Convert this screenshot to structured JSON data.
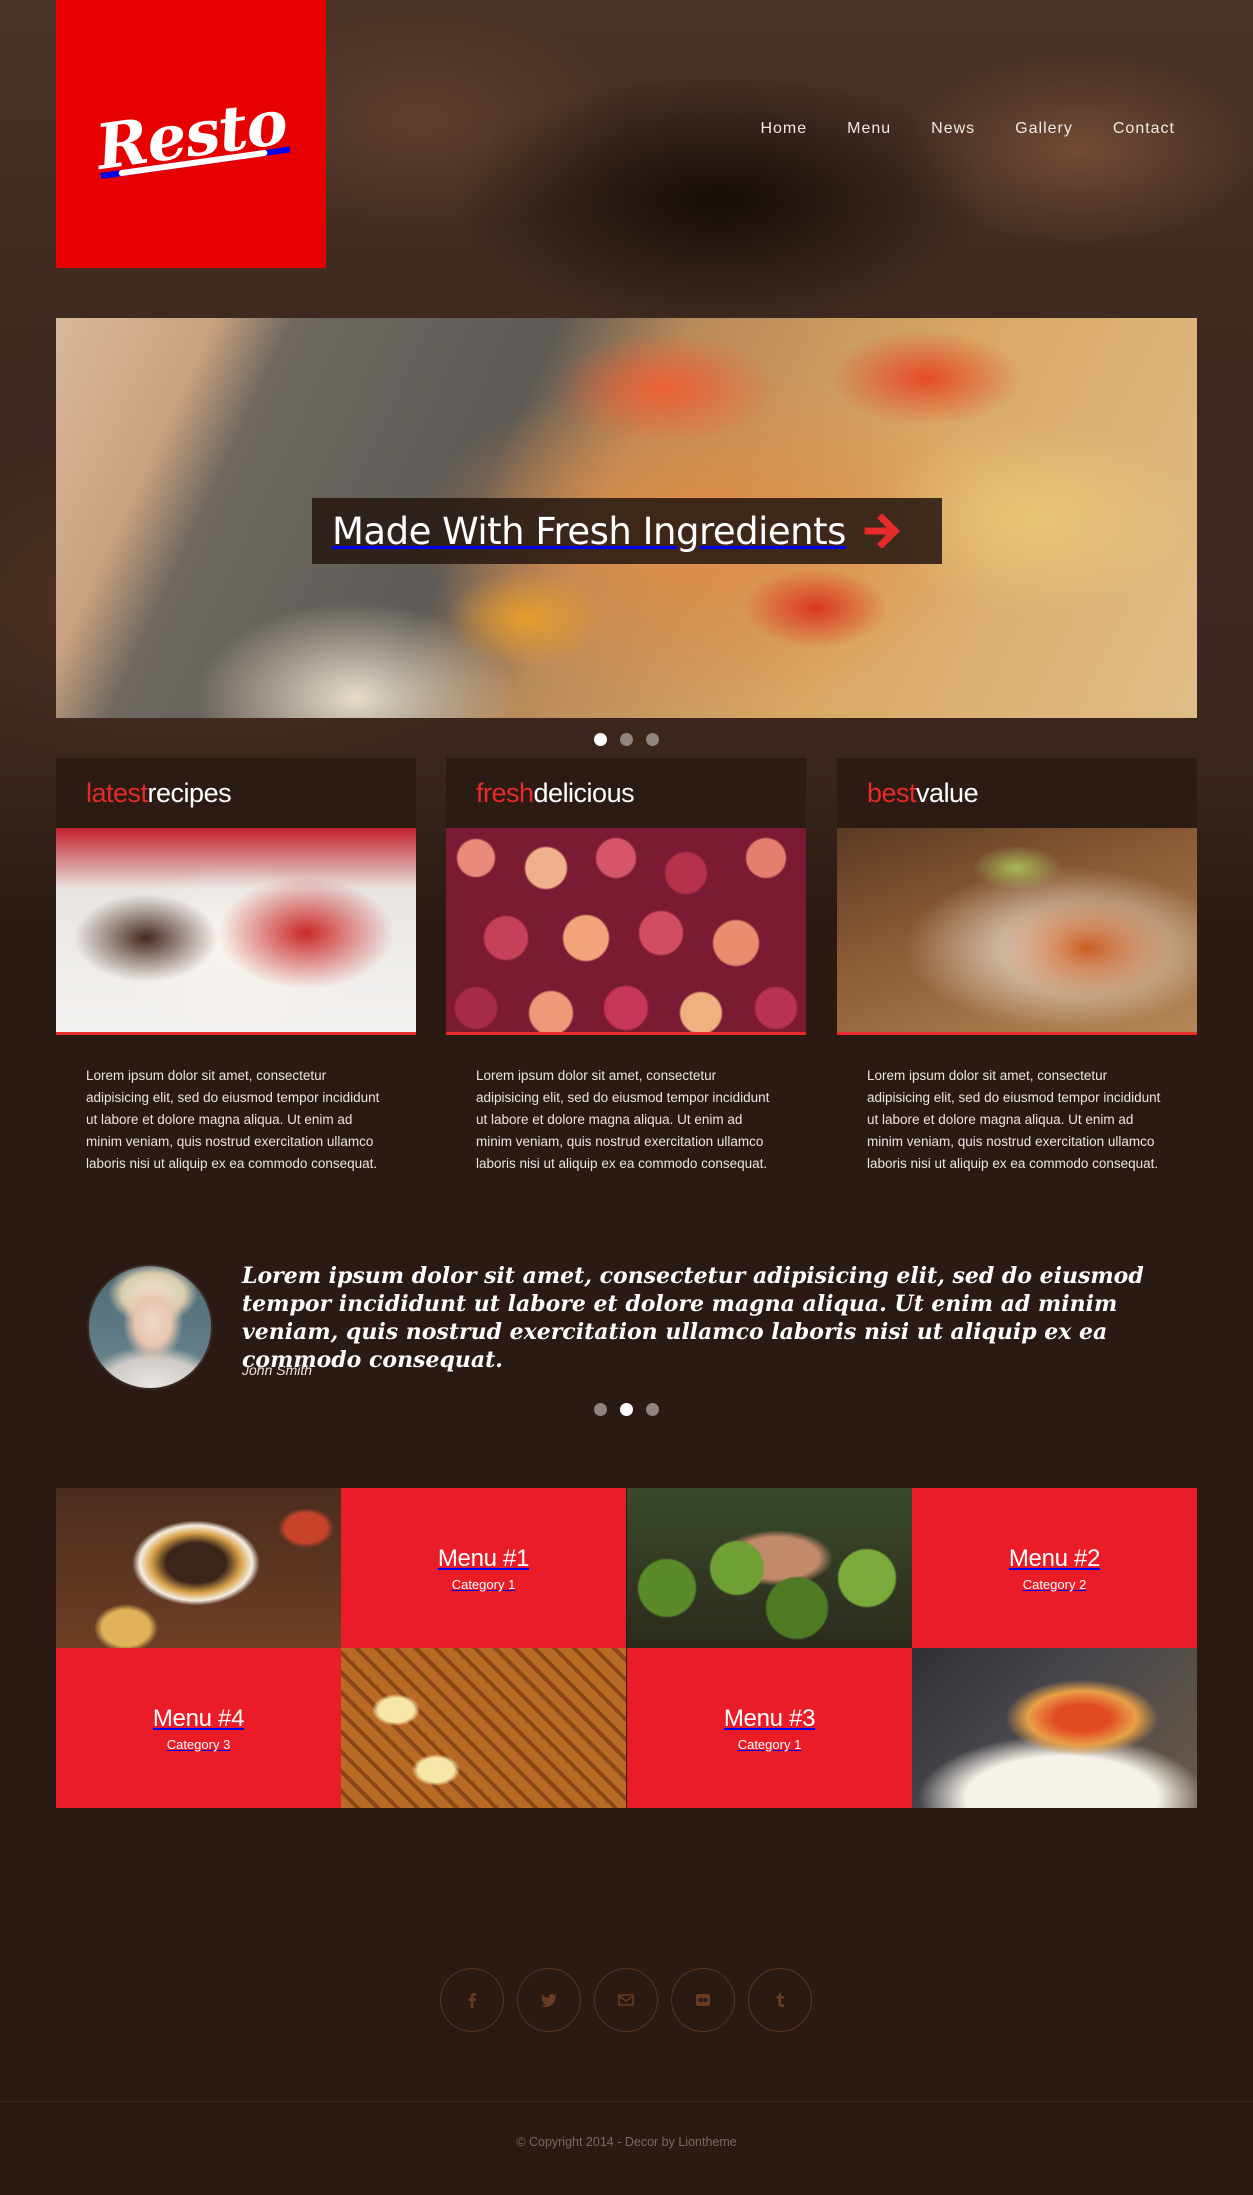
{
  "brand": {
    "logo_text": "Resto"
  },
  "nav": {
    "items": [
      {
        "label": "Home"
      },
      {
        "label": "Menu"
      },
      {
        "label": "News"
      },
      {
        "label": "Gallery"
      },
      {
        "label": "Contact"
      }
    ]
  },
  "slider": {
    "caption": "Made With Fresh Ingredients",
    "arrow_icon": "arrow-right-icon",
    "slide_count": 3,
    "active_slide": 1
  },
  "features": [
    {
      "accent": "latest",
      "rest": "recipes",
      "text": "Lorem ipsum dolor sit amet, consectetur adipisicing elit, sed do eiusmod tempor incididunt ut labore et dolore magna aliqua. Ut enim ad minim veniam, quis nostrud exercitation ullamco laboris nisi ut aliquip ex ea commodo consequat."
    },
    {
      "accent": "fresh",
      "rest": "delicious",
      "text": "Lorem ipsum dolor sit amet, consectetur adipisicing elit, sed do eiusmod tempor incididunt ut labore et dolore magna aliqua. Ut enim ad minim veniam, quis nostrud exercitation ullamco laboris nisi ut aliquip ex ea commodo consequat."
    },
    {
      "accent": "best",
      "rest": "value",
      "text": "Lorem ipsum dolor sit amet, consectetur adipisicing elit, sed do eiusmod tempor incididunt ut labore et dolore magna aliqua. Ut enim ad minim veniam, quis nostrud exercitation ullamco laboris nisi ut aliquip ex ea commodo consequat."
    }
  ],
  "testimonial": {
    "quote": "Lorem ipsum dolor sit amet, consectetur adipisicing elit, sed do eiusmod tempor incididunt ut labore et dolore magna aliqua. Ut enim ad minim veniam, quis nostrud exercitation ullamco laboris nisi ut aliquip ex ea commodo consequat.",
    "author": "John Smith",
    "slide_count": 3,
    "active_slide": 2
  },
  "menu_tiles": [
    {
      "name": "Menu #1",
      "category": "Category 1"
    },
    {
      "name": "Menu #2",
      "category": "Category 2"
    },
    {
      "name": "Menu #4",
      "category": "Category 3"
    },
    {
      "name": "Menu #3",
      "category": "Category 1"
    }
  ],
  "social": [
    {
      "name": "facebook-icon"
    },
    {
      "name": "twitter-icon"
    },
    {
      "name": "envelope-icon"
    },
    {
      "name": "flickr-icon"
    },
    {
      "name": "tumblr-icon"
    }
  ],
  "footer": {
    "copyright": "© Copyright 2014 - Decor by Liontheme"
  },
  "colors": {
    "accent": "#e62b2b",
    "logo_bg": "#e60000",
    "tile_red": "#ea1c27",
    "page_bg": "#2a1a13"
  }
}
